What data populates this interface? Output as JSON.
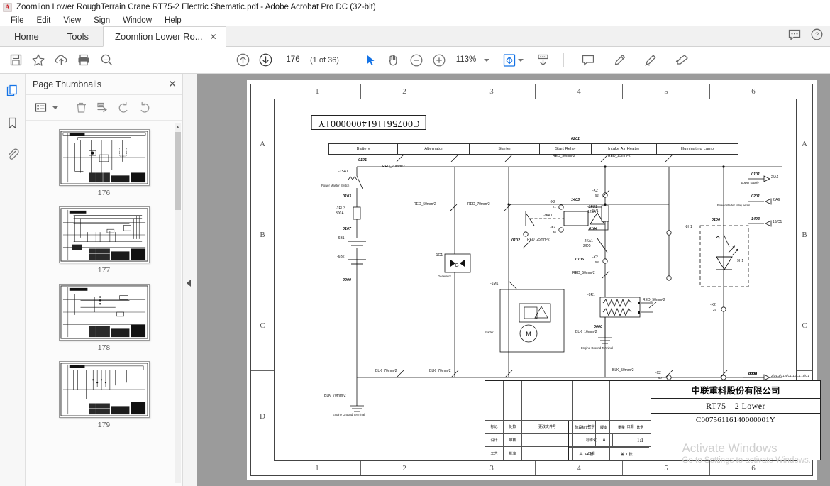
{
  "window": {
    "title": "Zoomlion Lower RoughTerrain Crane RT75-2 Electric Shematic.pdf - Adobe Acrobat Pro DC (32-bit)",
    "app_icon": "acrobat-icon"
  },
  "menu": {
    "items": [
      "File",
      "Edit",
      "View",
      "Sign",
      "Window",
      "Help"
    ]
  },
  "tabs": {
    "home": "Home",
    "tools": "Tools",
    "document": "Zoomlion Lower Ro...",
    "close_glyph": "✕",
    "right_icons": [
      "comment-balloon-icon",
      "help-circle-icon"
    ]
  },
  "toolbar": {
    "left_icons": [
      "save-icon",
      "star-icon",
      "upload-cloud-icon",
      "print-icon",
      "search-icon"
    ],
    "prev_page_icon": "arrow-up-circle-icon",
    "next_page_icon": "arrow-down-circle-icon",
    "page_number": "176",
    "page_total": "(1 of 36)",
    "select_tool_icon": "cursor-arrow-icon",
    "hand_tool_icon": "hand-icon",
    "zoom_out_icon": "minus-circle-icon",
    "zoom_in_icon": "plus-circle-icon",
    "zoom_level": "113%",
    "fit_page_icon": "fit-page-icon",
    "scroll_mode_icon": "scroll-mode-icon",
    "comment_icon": "comment-icon",
    "highlight_icon": "highlight-pen-icon",
    "draw_icon": "draw-freehand-icon",
    "sign_icon": "sign-icon"
  },
  "left_rail": {
    "items": [
      "page-thumbnails-icon",
      "bookmarks-icon",
      "attachments-icon"
    ]
  },
  "thumbnails_panel": {
    "title": "Page Thumbnails",
    "close_glyph": "✕",
    "tools": [
      "options-list-icon",
      "delete-icon",
      "extract-pages-icon",
      "rotate-ccw-icon",
      "rotate-cw-icon"
    ],
    "pages": [
      {
        "label": "176"
      },
      {
        "label": "177"
      },
      {
        "label": "178"
      },
      {
        "label": "179"
      }
    ]
  },
  "drawing": {
    "document_number_mirrored": "C00756116140000001Y",
    "column_labels": [
      "1",
      "2",
      "3",
      "4",
      "5",
      "6"
    ],
    "row_labels": [
      "A",
      "B",
      "C",
      "D"
    ],
    "function_headers": [
      "Battery",
      "Alternator",
      "Starter",
      "Start Relay",
      "Intake Air Heater",
      "Illuminating Lamp"
    ],
    "labels": [
      {
        "id": "wire-0101",
        "text": "0101"
      },
      {
        "id": "wire-red70-1",
        "text": "RED_70mm²2"
      },
      {
        "id": "dev-1sa1",
        "text": "-1SA1"
      },
      {
        "id": "dev-1sa1-desc",
        "text": "Power Master Switch"
      },
      {
        "id": "wire-0103",
        "text": "0103"
      },
      {
        "id": "dev-1fu3",
        "text": "-1FU3"
      },
      {
        "id": "dev-1fu3-rating",
        "text": "300A"
      },
      {
        "id": "wire-0107",
        "text": "0107"
      },
      {
        "id": "dev-6b1",
        "text": "-6B1"
      },
      {
        "id": "dev-6b2",
        "text": "-6B2"
      },
      {
        "id": "wire-0000-a",
        "text": "0000"
      },
      {
        "id": "wire-red50-1",
        "text": "RED_50mm²2"
      },
      {
        "id": "dev-1g1",
        "text": "-1G1"
      },
      {
        "id": "dev-1g1-desc",
        "text": "Generator"
      },
      {
        "id": "wire-red70-2",
        "text": "RED_70mm²2"
      },
      {
        "id": "dev-1m1",
        "text": "-1M1"
      },
      {
        "id": "dev-1m1-desc",
        "text": "Starter"
      },
      {
        "id": "wire-0201",
        "text": "0201"
      },
      {
        "id": "wire-red50-2",
        "text": "RED_50mm²2"
      },
      {
        "id": "wire-red25-1",
        "text": "RED_25mm²2"
      },
      {
        "id": "wire-1403",
        "text": "1403"
      },
      {
        "id": "dev-2ka1",
        "text": "-2KA1"
      },
      {
        "id": "dev-1v1",
        "text": "-1V1"
      },
      {
        "id": "term-x2-21",
        "text": "-X2"
      },
      {
        "id": "term-x2-21n",
        "text": "21"
      },
      {
        "id": "term-x2-30",
        "text": "-X2"
      },
      {
        "id": "term-x2-30n",
        "text": "30"
      },
      {
        "id": "term-x2-52",
        "text": "-X2"
      },
      {
        "id": "term-x2-52n",
        "text": "52"
      },
      {
        "id": "dev-1fu1",
        "text": "-1FU1"
      },
      {
        "id": "dev-1fu1-rating",
        "text": "125A"
      },
      {
        "id": "wire-0104",
        "text": "0104"
      },
      {
        "id": "dev-2ka1-ref",
        "text": "-2KA1"
      },
      {
        "id": "dev-2ka1-loc",
        "text": "2/D5"
      },
      {
        "id": "wire-0105",
        "text": "0105"
      },
      {
        "id": "term-x2-58",
        "text": "-X2"
      },
      {
        "id": "term-x2-58n",
        "text": "58"
      },
      {
        "id": "wire-red50-3",
        "text": "RED_50mm²2"
      },
      {
        "id": "dev-9r1",
        "text": "-9R1"
      },
      {
        "id": "wire-red50-4",
        "text": "RED_50mm²2"
      },
      {
        "id": "wire-0000-b",
        "text": "0000"
      },
      {
        "id": "wire-blk16-1",
        "text": "BLK_16mm²2"
      },
      {
        "id": "gnd-engine-2",
        "text": "Engine Ground Terminal"
      },
      {
        "id": "wire-0106",
        "text": "0106"
      },
      {
        "id": "dev-8h1",
        "text": "-8H1"
      },
      {
        "id": "dev-9h1",
        "text": "9H1"
      },
      {
        "id": "term-x2-29",
        "text": "-X2"
      },
      {
        "id": "term-x2-29n",
        "text": "29"
      },
      {
        "id": "term-x2-60",
        "text": "-X2"
      },
      {
        "id": "term-x2-60n",
        "text": "60"
      },
      {
        "id": "wire-blk50-1",
        "text": "BLK_50mm²2"
      },
      {
        "id": "wire-blk70-1",
        "text": "BLK_70mm²2"
      },
      {
        "id": "wire-blk70-2",
        "text": "BLK_70mm²2"
      },
      {
        "id": "wire-blk70-3",
        "text": "BLK_70mm²2"
      },
      {
        "id": "gnd-engine-1",
        "text": "Engine Ground Terminal"
      },
      {
        "id": "wire-0202",
        "text": "0102"
      },
      {
        "id": "wire-red25-2",
        "text": "RED_25mm²2"
      },
      {
        "id": "wire-0000-c",
        "text": "0000"
      }
    ],
    "cross_refs": [
      {
        "wire": "0101",
        "target": "2/A1",
        "desc": "power supply",
        "dir": "out"
      },
      {
        "wire": "0201",
        "target": "2/A6",
        "desc": "Power starter relay wires",
        "dir": "in"
      },
      {
        "wire": "1403",
        "target": "13/C1",
        "desc": "",
        "dir": "in"
      },
      {
        "wire": "0000",
        "target": "2/D1,3/C1,4/C1,12/C1,15/C1",
        "desc": "",
        "dir": "out"
      }
    ],
    "title_block": {
      "company": "中联重科股份有限公司",
      "model": "RT75—2 Lower",
      "drawing_code": "C00756116140000001Y",
      "revision_columns": [
        "标记",
        "处数",
        "更改文件号",
        "签字",
        "日期"
      ],
      "signoff_rows": [
        [
          "设计",
          "审核"
        ],
        [
          "工艺",
          "标准化"
        ],
        [
          "批准",
          "日期"
        ]
      ],
      "meta_headers": [
        "阶段标记",
        "版本",
        "重量",
        "比例"
      ],
      "meta_values": [
        "",
        "A",
        "",
        "1:1"
      ],
      "sheet_info": [
        "共 34 张",
        "第 1 张"
      ]
    }
  },
  "watermark": {
    "line1": "Activate Windows",
    "line2": "Go to Settings to activate Windows."
  }
}
